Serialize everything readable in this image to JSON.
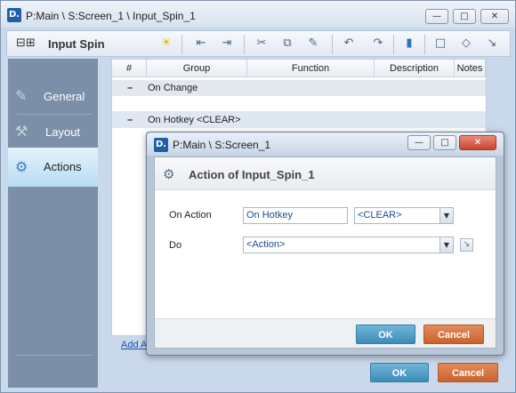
{
  "window": {
    "title": "P:Main \\ S:Screen_1 \\ Input_Spin_1",
    "logo": "D.",
    "minimize": "—",
    "maximize": "□",
    "close": "✕"
  },
  "toolbar": {
    "component_icon": "⊟⊞",
    "title": "Input Spin",
    "icons": [
      "lightbulb-icon",
      "outdent-icon",
      "indent-icon",
      "cut-icon",
      "copy-icon",
      "paste-icon",
      "undo-icon",
      "redo-icon",
      "comment-icon",
      "speech-bubble-icon",
      "diamond-icon",
      "jump-icon"
    ]
  },
  "sidebar": {
    "items": [
      {
        "label": "General",
        "icon": "general-icon"
      },
      {
        "label": "Layout",
        "icon": "layout-icon"
      },
      {
        "label": "Actions",
        "icon": "actions-icon"
      }
    ],
    "active": "Actions"
  },
  "grid": {
    "columns": [
      "#",
      "Group",
      "Function",
      "Description",
      "Notes"
    ],
    "rows": [
      {
        "toggle": "–",
        "text": "On Change"
      },
      {
        "toggle": "–",
        "text": "On Hotkey <CLEAR>"
      }
    ],
    "add_link": "Add A"
  },
  "footer": {
    "ok": "OK",
    "cancel": "Cancel"
  },
  "dialog": {
    "title": "P:Main \\ S:Screen_1",
    "logo": "D.",
    "heading": "Action of Input_Spin_1",
    "on_action_label": "On Action",
    "on_action_value": "On Hotkey",
    "hotkey_value": "<CLEAR>",
    "do_label": "Do",
    "do_value": "<Action>",
    "ok": "OK",
    "cancel": "Cancel"
  }
}
